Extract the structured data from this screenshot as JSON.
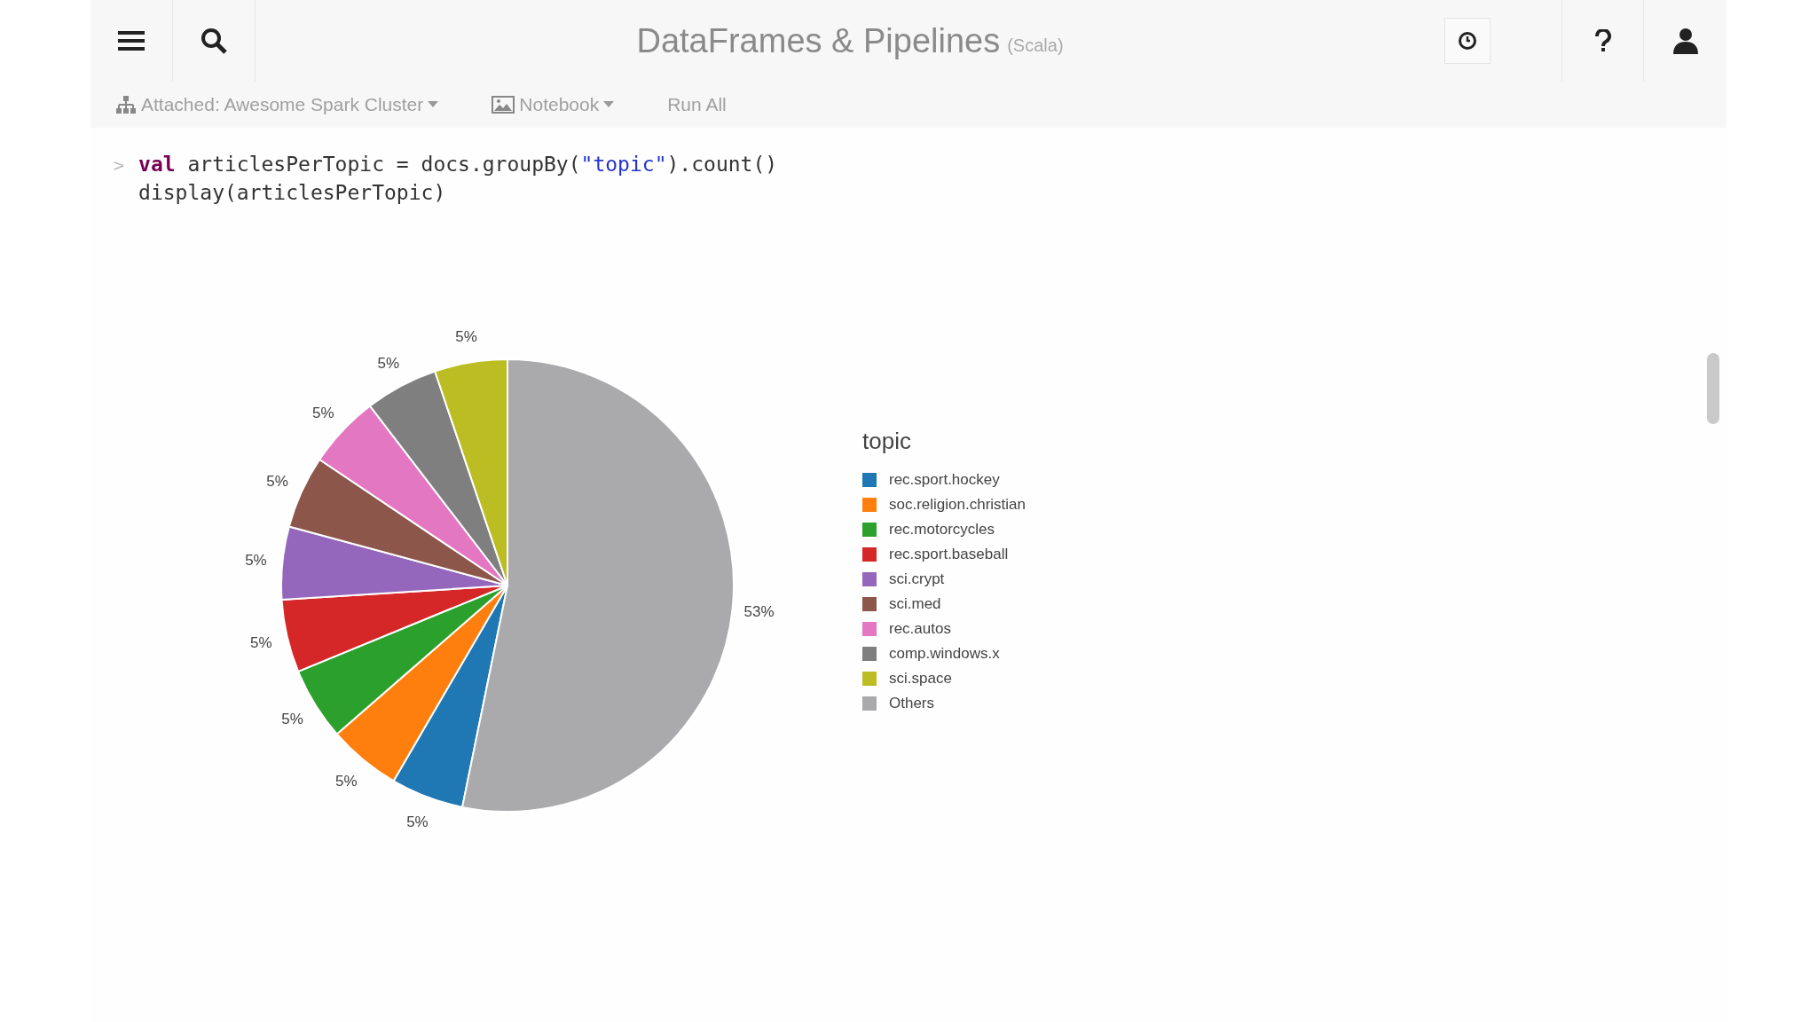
{
  "header": {
    "title": "DataFrames & Pipelines",
    "language": "(Scala)"
  },
  "toolbar": [
    {
      "label": "Attached: Awesome Spark Cluster",
      "kind": "cluster"
    },
    {
      "label": "Notebook",
      "kind": "notebook"
    },
    {
      "label": "Run All",
      "kind": "plain"
    }
  ],
  "cell": {
    "prompt": ">",
    "lines": [
      [
        {
          "text": "val",
          "kind": "keyword"
        },
        {
          "text": " articlesPerTopic = docs.groupBy(",
          "kind": "plain"
        },
        {
          "text": "\"topic\"",
          "kind": "string"
        },
        {
          "text": ").count()",
          "kind": "plain"
        }
      ],
      [
        {
          "text": "display(articlesPerTopic)",
          "kind": "plain"
        }
      ]
    ]
  },
  "output": {
    "chart_data": {
      "type": "pie",
      "title": "topic",
      "categories": [
        "rec.sport.hockey",
        "soc.religion.christian",
        "rec.motorcycles",
        "rec.sport.baseball",
        "sci.crypt",
        "sci.med",
        "rec.autos",
        "comp.windows.x",
        "sci.space",
        "Others"
      ],
      "values": [
        5.2,
        5.2,
        5.2,
        5.2,
        5.2,
        5.2,
        5.2,
        5.2,
        5.2,
        53.2
      ],
      "colors": [
        "#1f77b4",
        "#ff7f0e",
        "#2ca02c",
        "#d62728",
        "#9467bd",
        "#8c564b",
        "#e377c2",
        "#7f7f7f",
        "#bcbd22",
        "#aaa9ab"
      ],
      "value_labels": [
        "5%",
        "5%",
        "5%",
        "5%",
        "5%",
        "5%",
        "5%",
        "5%",
        "5%",
        "53%"
      ]
    }
  }
}
